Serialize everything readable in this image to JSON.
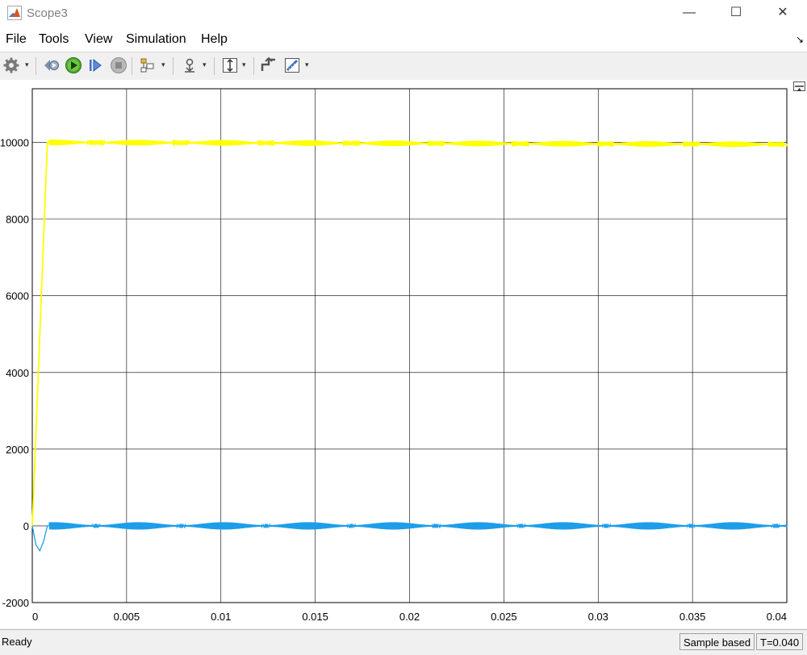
{
  "window": {
    "title": "Scope3",
    "minimize_glyph": "—",
    "maximize_glyph": "☐",
    "close_glyph": "✕"
  },
  "menu": {
    "items": [
      "File",
      "Tools",
      "View",
      "Simulation",
      "Help"
    ],
    "overflow_glyph": "↘"
  },
  "toolbar": {
    "buttons": [
      {
        "name": "configuration-properties-icon",
        "dropdown": true
      },
      {
        "name": "step-back-icon",
        "dropdown": false
      },
      {
        "name": "run-icon",
        "dropdown": false
      },
      {
        "name": "step-forward-icon",
        "dropdown": false
      },
      {
        "name": "stop-icon",
        "dropdown": false
      },
      {
        "name": "highlight-simulink-block-icon",
        "dropdown": true
      },
      {
        "name": "triggers-icon",
        "dropdown": true
      },
      {
        "name": "zoom-icon",
        "dropdown": true
      },
      {
        "name": "restore-layout-icon",
        "dropdown": false
      },
      {
        "name": "measurements-icon",
        "dropdown": true
      }
    ],
    "dropdown_glyph": "▾"
  },
  "status": {
    "left": "Ready",
    "mode": "Sample based",
    "time": "T=0.040"
  },
  "colors": {
    "background": "#ffffff",
    "grid": "#000000",
    "series_1": "#ffff00",
    "series_2": "#1e9ee8"
  },
  "chart_data": {
    "type": "line",
    "xlim": [
      0,
      0.04
    ],
    "ylim": [
      -2000,
      11400
    ],
    "x_ticks": [
      0,
      0.005,
      0.01,
      0.015,
      0.02,
      0.025,
      0.03,
      0.035,
      0.04
    ],
    "x_tick_labels": [
      "0",
      "0.005",
      "0.01",
      "0.015",
      "0.02",
      "0.025",
      "0.03",
      "0.035",
      "0.04"
    ],
    "y_ticks": [
      -2000,
      0,
      2000,
      4000,
      6000,
      8000,
      10000
    ],
    "y_tick_labels": [
      "-2000",
      "0",
      "2000",
      "4000",
      "6000",
      "8000",
      "10000"
    ],
    "grid": true,
    "series": [
      {
        "color": "#ffff00",
        "points": [
          [
            0,
            0
          ],
          [
            0.0008,
            10000
          ],
          [
            0.04,
            9950
          ]
        ],
        "ripple": 60
      },
      {
        "color": "#1e9ee8",
        "points": [
          [
            0,
            0
          ],
          [
            0.0002,
            -500
          ],
          [
            0.0004,
            -650
          ],
          [
            0.0006,
            -400
          ],
          [
            0.0008,
            0
          ],
          [
            0.04,
            0
          ]
        ],
        "ripple": 80
      }
    ]
  }
}
